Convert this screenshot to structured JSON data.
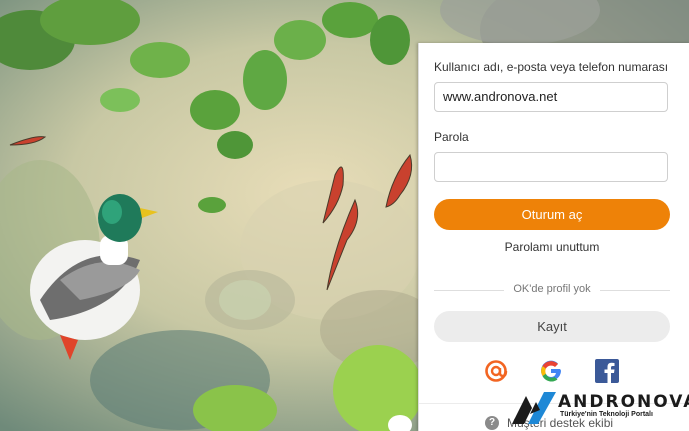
{
  "login": {
    "login_label": "Kullanıcı adı, e-posta veya telefon numarası",
    "login_value": "www.andronova.net",
    "password_label": "Parola",
    "password_value": "",
    "submit_label": "Oturum aç",
    "forgot_label": "Parolamı unuttum",
    "divider_text": "OK'de profil yok",
    "register_label": "Kayıt",
    "support_label": "Müşteri destek ekibi"
  },
  "social": [
    {
      "icon": "mail-ru-at-icon",
      "color": "#f26522"
    },
    {
      "icon": "google-icon",
      "color": "#4285f4"
    },
    {
      "icon": "facebook-icon",
      "color": "#3b5998"
    }
  ],
  "watermark": {
    "brand": "ANDRONOVA",
    "tagline": "Türkiye'nin Teknoloji Portalı",
    "colors": {
      "accent": "#1e88d6",
      "dark": "#1b1b1b"
    }
  },
  "colors": {
    "primary": "#ee8208",
    "secondary": "#ececec"
  }
}
